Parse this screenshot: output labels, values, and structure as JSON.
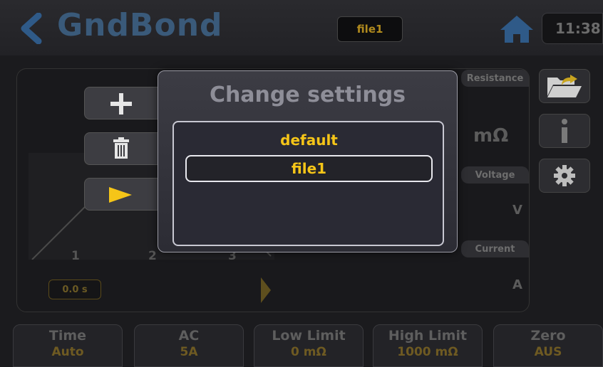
{
  "header": {
    "title": "GndBond",
    "file_badge": "file1",
    "clock": "11:38"
  },
  "graph": {
    "x_ticks": [
      "1",
      "2",
      "3"
    ],
    "time_badge": "0.0 s"
  },
  "measurements": [
    {
      "label": "Resistance",
      "unit": "mΩ"
    },
    {
      "label": "Voltage",
      "unit": "V"
    },
    {
      "label": "Current",
      "unit": "A"
    }
  ],
  "bottom_params": [
    {
      "label": "Time",
      "value": "Auto"
    },
    {
      "label": "AC",
      "value": "5A"
    },
    {
      "label": "Low Limit",
      "value": "0 mΩ"
    },
    {
      "label": "High Limit",
      "value": "1000 mΩ"
    },
    {
      "label": "Zero",
      "value": "AUS"
    }
  ],
  "modal": {
    "title": "Change settings",
    "items": [
      "default",
      "file1"
    ],
    "selected_index": 1
  },
  "colors": {
    "accent": "#f5c518",
    "title_blue": "#3a5a7a"
  }
}
